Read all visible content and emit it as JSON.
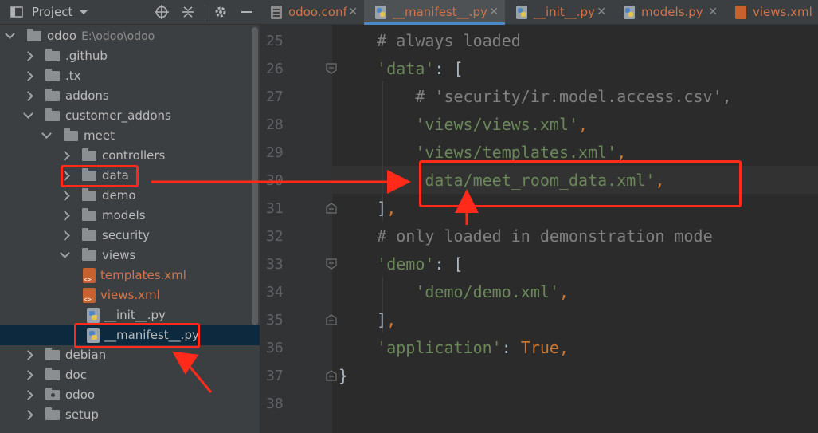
{
  "project_panel": {
    "title": "Project",
    "header_icons": [
      "target-icon",
      "collapse-icon",
      "gear-icon",
      "minimize-icon"
    ],
    "tree": [
      {
        "label": "odoo",
        "hint": "E:\\odoo\\odoo",
        "type": "folder",
        "expanded": true,
        "depth": 0
      },
      {
        "label": ".github",
        "type": "folder",
        "expanded": false,
        "depth": 1
      },
      {
        "label": ".tx",
        "type": "folder",
        "expanded": false,
        "depth": 1
      },
      {
        "label": "addons",
        "type": "folder",
        "expanded": false,
        "depth": 1
      },
      {
        "label": "customer_addons",
        "type": "folder",
        "expanded": true,
        "depth": 1
      },
      {
        "label": "meet",
        "type": "folder",
        "expanded": true,
        "depth": 2
      },
      {
        "label": "controllers",
        "type": "folder",
        "expanded": false,
        "depth": 3
      },
      {
        "label": "data",
        "type": "folder",
        "expanded": false,
        "depth": 3
      },
      {
        "label": "demo",
        "type": "folder",
        "expanded": false,
        "depth": 3
      },
      {
        "label": "models",
        "type": "folder",
        "expanded": false,
        "depth": 3
      },
      {
        "label": "security",
        "type": "folder",
        "expanded": false,
        "depth": 3
      },
      {
        "label": "views",
        "type": "folder",
        "expanded": true,
        "depth": 3
      },
      {
        "label": "templates.xml",
        "type": "xml",
        "depth": 4
      },
      {
        "label": "views.xml",
        "type": "xml",
        "depth": 4
      },
      {
        "label": "__init__.py",
        "type": "py",
        "depth": 3
      },
      {
        "label": "__manifest__.py",
        "type": "py",
        "depth": 3,
        "selected": true
      },
      {
        "label": "debian",
        "type": "folder",
        "expanded": false,
        "depth": 1
      },
      {
        "label": "doc",
        "type": "folder",
        "expanded": false,
        "depth": 1
      },
      {
        "label": "odoo",
        "type": "folder-dot",
        "expanded": false,
        "depth": 1
      },
      {
        "label": "setup",
        "type": "folder",
        "expanded": false,
        "depth": 1
      }
    ]
  },
  "tabs": [
    {
      "label": "odoo.conf",
      "icon": "config-file-icon",
      "active": false,
      "modified": true
    },
    {
      "label": "__manifest__.py",
      "icon": "python-file-icon",
      "active": true,
      "modified": true
    },
    {
      "label": "__init__.py",
      "icon": "python-file-icon",
      "active": false,
      "modified": true
    },
    {
      "label": "models.py",
      "icon": "python-file-icon",
      "active": false,
      "modified": true
    },
    {
      "label": "views.xml",
      "icon": "xml-file-icon",
      "active": false,
      "modified": true
    }
  ],
  "editor": {
    "lines": [
      {
        "no": "25",
        "text": "    # always loaded"
      },
      {
        "no": "26",
        "text": "    'data': ["
      },
      {
        "no": "27",
        "text": "        # 'security/ir.model.access.csv',"
      },
      {
        "no": "28",
        "text": "        'views/views.xml',"
      },
      {
        "no": "29",
        "text": "        'views/templates.xml',"
      },
      {
        "no": "30",
        "text": "        'data/meet_room_data.xml',"
      },
      {
        "no": "31",
        "text": "    ],"
      },
      {
        "no": "32",
        "text": "    # only loaded in demonstration mode"
      },
      {
        "no": "33",
        "text": "    'demo': ["
      },
      {
        "no": "34",
        "text": "        'demo/demo.xml',"
      },
      {
        "no": "35",
        "text": "    ],"
      },
      {
        "no": "36",
        "text": "    'application': True,"
      },
      {
        "no": "37",
        "text": "}"
      },
      {
        "no": "38",
        "text": ""
      }
    ]
  },
  "colors": {
    "annotation": "#ff2a1a",
    "string": "#6a8759",
    "comment": "#808080",
    "keyword": "#cc7832"
  }
}
